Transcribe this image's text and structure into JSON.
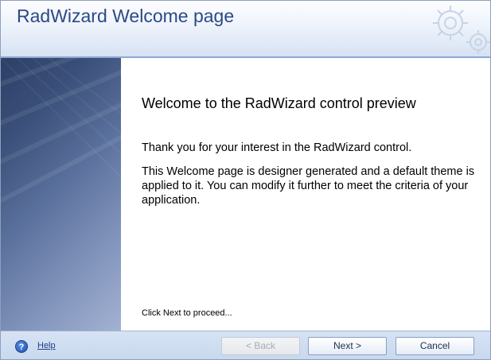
{
  "window": {
    "title": "RadWizard Welcome page"
  },
  "welcome_page": {
    "title": "Welcome to the RadWizard control preview",
    "paragraph1": "Thank you for your interest in the RadWizard control.",
    "paragraph2": "This Welcome page is designer generated and a default theme is applied to it.  You can modify it further to meet the criteria of your application.",
    "proceed_hint": "Click Next to proceed..."
  },
  "footer": {
    "help_label": "Help",
    "help_icon_glyph": "?",
    "back_label": "<  Back",
    "next_label": "Next  >",
    "cancel_label": "Cancel"
  },
  "icons": {
    "header_decoration": "gear-icon",
    "help": "help-icon"
  },
  "colors": {
    "title_text": "#2a4a86",
    "header_accent_line": "#8aa8d2",
    "link": "#1e3f8a"
  }
}
